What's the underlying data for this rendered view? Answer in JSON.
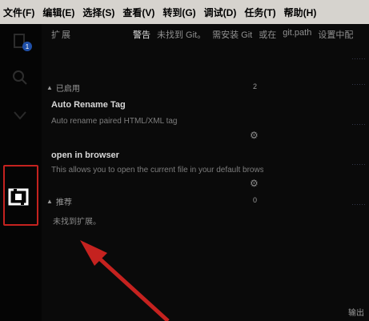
{
  "menu": [
    "文件(F)",
    "编辑(E)",
    "选择(S)",
    "查看(V)",
    "转到(G)",
    "调试(D)",
    "任务(T)",
    "帮助(H)"
  ],
  "activity": {
    "badge_count": "1"
  },
  "header": {
    "sidebar_title": "扩展",
    "tabs": [
      "警告",
      "未找到 Git。",
      "需安装 Git",
      "或在",
      "git.path",
      "设置中配"
    ]
  },
  "sections": {
    "installed": {
      "label": "已启用",
      "count": "2"
    },
    "recommended": {
      "label": "推荐",
      "count": "0"
    }
  },
  "extensions": [
    {
      "name": "Auto Rename Tag",
      "description": "Auto rename paired HTML/XML tag"
    },
    {
      "name": "open in browser",
      "description": "This allows you to open the current file in your default browser"
    }
  ],
  "recommended_empty": "未找到扩展。",
  "status": {
    "output": "输出"
  },
  "colors": {
    "highlight": "#c5221f",
    "badge": "#1f4fa8"
  }
}
